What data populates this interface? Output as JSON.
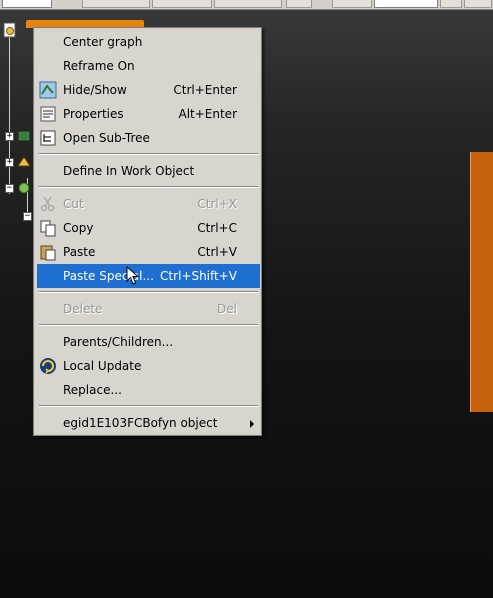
{
  "menu": {
    "items": [
      {
        "label": "Center graph",
        "shortcut": "",
        "enabled": true,
        "icon": ""
      },
      {
        "label": "Reframe On",
        "shortcut": "",
        "enabled": true,
        "icon": ""
      },
      {
        "label": "Hide/Show",
        "shortcut": "Ctrl+Enter",
        "enabled": true,
        "icon": "hide-show-icon"
      },
      {
        "label": "Properties",
        "shortcut": "Alt+Enter",
        "enabled": true,
        "icon": "properties-icon"
      },
      {
        "label": "Open Sub-Tree",
        "shortcut": "",
        "enabled": true,
        "icon": "sub-tree-icon"
      },
      {
        "label": "Define In Work Object",
        "shortcut": "",
        "enabled": true,
        "icon": ""
      },
      {
        "label": "Cut",
        "shortcut": "Ctrl+X",
        "enabled": false,
        "icon": "scissors-icon"
      },
      {
        "label": "Copy",
        "shortcut": "Ctrl+C",
        "enabled": true,
        "icon": "copy-icon"
      },
      {
        "label": "Paste",
        "shortcut": "Ctrl+V",
        "enabled": true,
        "icon": "paste-icon"
      },
      {
        "label": "Paste Special...",
        "shortcut": "Ctrl+Shift+V",
        "enabled": true,
        "highlighted": true,
        "icon": ""
      },
      {
        "label": "Delete",
        "shortcut": "Del",
        "enabled": false,
        "icon": ""
      },
      {
        "label": "Parents/Children...",
        "shortcut": "",
        "enabled": true,
        "icon": ""
      },
      {
        "label": "Local Update",
        "shortcut": "",
        "enabled": true,
        "icon": "local-update-icon"
      },
      {
        "label": "Replace...",
        "shortcut": "",
        "enabled": true,
        "icon": ""
      },
      {
        "label": "egid1E103FCBofyn object",
        "shortcut": "",
        "enabled": true,
        "submenu": true,
        "icon": ""
      }
    ]
  },
  "colors": {
    "highlight": "#1f6fd1",
    "menu_bg": "#d8d5cf",
    "tree_selection": "#e9840f",
    "part_orange": "#c9620e"
  }
}
